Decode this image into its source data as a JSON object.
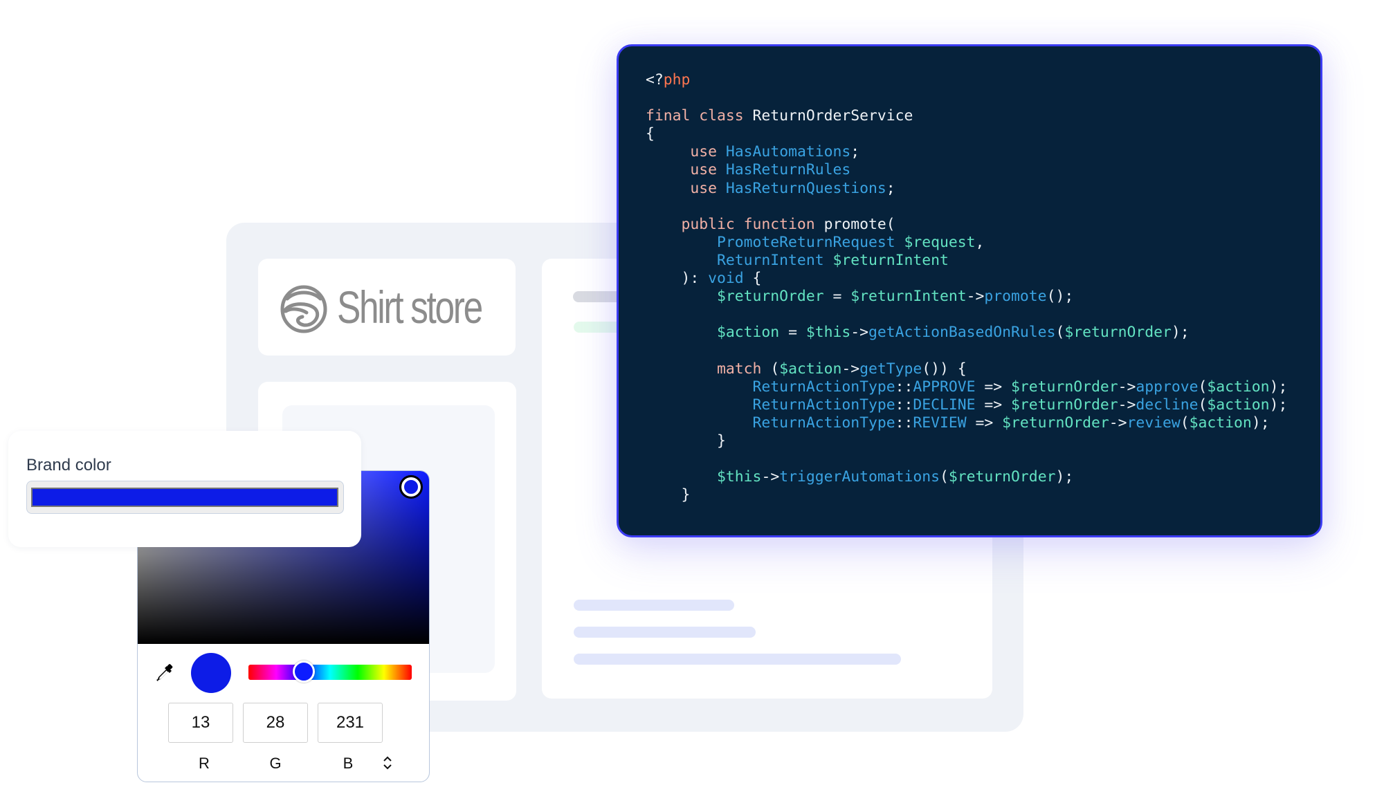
{
  "store": {
    "name": "Shirt store",
    "logo_icon": "globe-swirl-logo"
  },
  "code": {
    "language": "php",
    "lines": [
      [
        [
          "plain",
          "<?"
        ],
        [
          "php",
          "php"
        ]
      ],
      [],
      [
        [
          "kw",
          "final class "
        ],
        [
          "plain",
          "ReturnOrderService"
        ]
      ],
      [
        [
          "plain",
          "{"
        ]
      ],
      [
        [
          "plain",
          "     "
        ],
        [
          "kw",
          "use "
        ],
        [
          "type",
          "HasAutomations"
        ],
        [
          "plain",
          ";"
        ]
      ],
      [
        [
          "plain",
          "     "
        ],
        [
          "kw",
          "use "
        ],
        [
          "type",
          "HasReturnRules"
        ]
      ],
      [
        [
          "plain",
          "     "
        ],
        [
          "kw",
          "use "
        ],
        [
          "type",
          "HasReturnQuestions"
        ],
        [
          "plain",
          ";"
        ]
      ],
      [],
      [
        [
          "plain",
          "    "
        ],
        [
          "kw",
          "public function "
        ],
        [
          "plain",
          "promote("
        ]
      ],
      [
        [
          "plain",
          "        "
        ],
        [
          "type",
          "PromoteReturnRequest "
        ],
        [
          "var",
          "$request"
        ],
        [
          "plain",
          ","
        ]
      ],
      [
        [
          "plain",
          "        "
        ],
        [
          "type",
          "ReturnIntent "
        ],
        [
          "var",
          "$returnIntent"
        ]
      ],
      [
        [
          "plain",
          "    ): "
        ],
        [
          "type",
          "void"
        ],
        [
          "plain",
          " {"
        ]
      ],
      [
        [
          "plain",
          "        "
        ],
        [
          "var",
          "$returnOrder"
        ],
        [
          "plain",
          " = "
        ],
        [
          "var",
          "$returnIntent"
        ],
        [
          "plain",
          "->"
        ],
        [
          "fn",
          "promote"
        ],
        [
          "plain",
          "();"
        ]
      ],
      [],
      [
        [
          "plain",
          "        "
        ],
        [
          "var",
          "$action"
        ],
        [
          "plain",
          " = "
        ],
        [
          "var",
          "$this"
        ],
        [
          "plain",
          "->"
        ],
        [
          "fn",
          "getActionBasedOnRules"
        ],
        [
          "plain",
          "("
        ],
        [
          "var",
          "$returnOrder"
        ],
        [
          "plain",
          ");"
        ]
      ],
      [],
      [
        [
          "plain",
          "        "
        ],
        [
          "kw",
          "match "
        ],
        [
          "plain",
          "("
        ],
        [
          "var",
          "$action"
        ],
        [
          "plain",
          "->"
        ],
        [
          "fn",
          "getType"
        ],
        [
          "plain",
          "()) {"
        ]
      ],
      [
        [
          "plain",
          "            "
        ],
        [
          "type",
          "ReturnActionType"
        ],
        [
          "plain",
          "::"
        ],
        [
          "type",
          "APPROVE"
        ],
        [
          "plain",
          " => "
        ],
        [
          "var",
          "$returnOrder"
        ],
        [
          "plain",
          "->"
        ],
        [
          "fn",
          "approve"
        ],
        [
          "plain",
          "("
        ],
        [
          "var",
          "$action"
        ],
        [
          "plain",
          ");"
        ]
      ],
      [
        [
          "plain",
          "            "
        ],
        [
          "type",
          "ReturnActionType"
        ],
        [
          "plain",
          "::"
        ],
        [
          "type",
          "DECLINE"
        ],
        [
          "plain",
          " => "
        ],
        [
          "var",
          "$returnOrder"
        ],
        [
          "plain",
          "->"
        ],
        [
          "fn",
          "decline"
        ],
        [
          "plain",
          "("
        ],
        [
          "var",
          "$action"
        ],
        [
          "plain",
          ");"
        ]
      ],
      [
        [
          "plain",
          "            "
        ],
        [
          "type",
          "ReturnActionType"
        ],
        [
          "plain",
          "::"
        ],
        [
          "type",
          "REVIEW"
        ],
        [
          "plain",
          " => "
        ],
        [
          "var",
          "$returnOrder"
        ],
        [
          "plain",
          "->"
        ],
        [
          "fn",
          "review"
        ],
        [
          "plain",
          "("
        ],
        [
          "var",
          "$action"
        ],
        [
          "plain",
          ");"
        ]
      ],
      [
        [
          "plain",
          "        }"
        ]
      ],
      [],
      [
        [
          "plain",
          "        "
        ],
        [
          "var",
          "$this"
        ],
        [
          "plain",
          "->"
        ],
        [
          "fn",
          "triggerAutomations"
        ],
        [
          "plain",
          "("
        ],
        [
          "var",
          "$returnOrder"
        ],
        [
          "plain",
          ");"
        ]
      ],
      [
        [
          "plain",
          "    }"
        ]
      ]
    ]
  },
  "brand_color": {
    "label": "Brand color",
    "value_hex": "#0d1ce7"
  },
  "color_picker": {
    "hue_fraction": 0.34,
    "saturation_fraction": 1.0,
    "value_fraction": 0.91,
    "rgb": {
      "r": "13",
      "g": "28",
      "b": "231"
    },
    "labels": {
      "r": "R",
      "g": "G",
      "b": "B"
    },
    "mode_toggle_icon": "up-down-chevron-icon",
    "eyedropper_icon": "eyedropper-icon"
  },
  "colors": {
    "accent_border": "#3b3bf2",
    "code_background": "#06223b",
    "brand": "#0d1ce7"
  }
}
